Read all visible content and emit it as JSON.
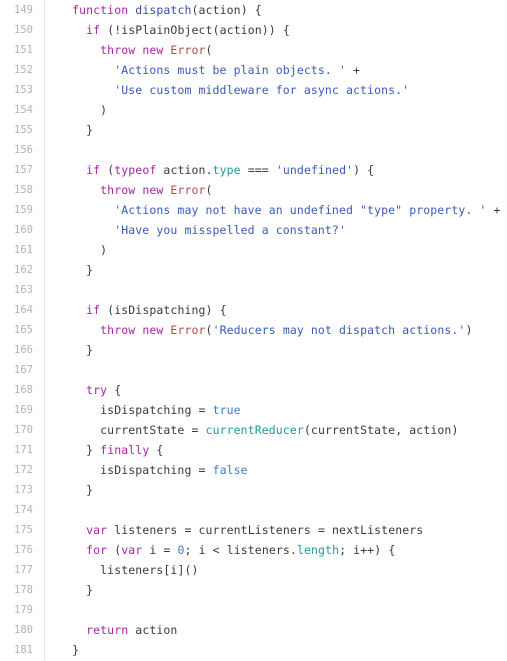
{
  "viewer": {
    "name": "code-viewer",
    "language": "javascript",
    "background_color": "#ffffff",
    "gutter_divider_color": "#e6e6ea",
    "line_number_color": "#b2b3bb",
    "default_text_color": "#383a42",
    "first_line_number": 149,
    "last_line_number": 181,
    "total_lines": 33
  },
  "theme_colors": {
    "keyword": "#a626a4",
    "string": "#3b5bb5",
    "number": "#3b7cc4",
    "boolean": "#3b7cc4",
    "property": "#1d9b9b",
    "function_call": "#1d9b9b",
    "class_name": "#b34a4a",
    "function_name": "#3b4b9b",
    "plain": "#383a42"
  },
  "lines": [
    {
      "number": "149",
      "text": "  function dispatch(action) {",
      "tokens": [
        {
          "t": "  ",
          "k": "plain"
        },
        {
          "t": "function",
          "k": "keyword"
        },
        {
          "t": " ",
          "k": "plain"
        },
        {
          "t": "dispatch",
          "k": "fnname"
        },
        {
          "t": "(",
          "k": "punct"
        },
        {
          "t": "action",
          "k": "plain"
        },
        {
          "t": ") {",
          "k": "punct"
        }
      ]
    },
    {
      "number": "150",
      "text": "    if (!isPlainObject(action)) {",
      "tokens": [
        {
          "t": "    ",
          "k": "plain"
        },
        {
          "t": "if",
          "k": "keyword"
        },
        {
          "t": " (!",
          "k": "punct"
        },
        {
          "t": "isPlainObject",
          "k": "plain"
        },
        {
          "t": "(",
          "k": "punct"
        },
        {
          "t": "action",
          "k": "plain"
        },
        {
          "t": ")) {",
          "k": "punct"
        }
      ]
    },
    {
      "number": "151",
      "text": "      throw new Error(",
      "tokens": [
        {
          "t": "      ",
          "k": "plain"
        },
        {
          "t": "throw",
          "k": "keyword"
        },
        {
          "t": " ",
          "k": "plain"
        },
        {
          "t": "new",
          "k": "keyword"
        },
        {
          "t": " ",
          "k": "plain"
        },
        {
          "t": "Error",
          "k": "class"
        },
        {
          "t": "(",
          "k": "punct"
        }
      ]
    },
    {
      "number": "152",
      "text": "        'Actions must be plain objects. ' +",
      "tokens": [
        {
          "t": "        ",
          "k": "plain"
        },
        {
          "t": "'Actions must be plain objects. '",
          "k": "string"
        },
        {
          "t": " ",
          "k": "plain"
        },
        {
          "t": "+",
          "k": "operator"
        }
      ]
    },
    {
      "number": "153",
      "text": "        'Use custom middleware for async actions.'",
      "tokens": [
        {
          "t": "        ",
          "k": "plain"
        },
        {
          "t": "'Use custom middleware for async actions.'",
          "k": "string"
        }
      ]
    },
    {
      "number": "154",
      "text": "      )",
      "tokens": [
        {
          "t": "      ",
          "k": "plain"
        },
        {
          "t": ")",
          "k": "punct"
        }
      ]
    },
    {
      "number": "155",
      "text": "    }",
      "tokens": [
        {
          "t": "    ",
          "k": "plain"
        },
        {
          "t": "}",
          "k": "punct"
        }
      ]
    },
    {
      "number": "156",
      "text": "",
      "tokens": []
    },
    {
      "number": "157",
      "text": "    if (typeof action.type === 'undefined') {",
      "tokens": [
        {
          "t": "    ",
          "k": "plain"
        },
        {
          "t": "if",
          "k": "keyword"
        },
        {
          "t": " (",
          "k": "punct"
        },
        {
          "t": "typeof",
          "k": "keyword"
        },
        {
          "t": " ",
          "k": "plain"
        },
        {
          "t": "action",
          "k": "plain"
        },
        {
          "t": ".",
          "k": "punct"
        },
        {
          "t": "type",
          "k": "property"
        },
        {
          "t": " ",
          "k": "plain"
        },
        {
          "t": "===",
          "k": "operator"
        },
        {
          "t": " ",
          "k": "plain"
        },
        {
          "t": "'undefined'",
          "k": "string"
        },
        {
          "t": ") {",
          "k": "punct"
        }
      ]
    },
    {
      "number": "158",
      "text": "      throw new Error(",
      "tokens": [
        {
          "t": "      ",
          "k": "plain"
        },
        {
          "t": "throw",
          "k": "keyword"
        },
        {
          "t": " ",
          "k": "plain"
        },
        {
          "t": "new",
          "k": "keyword"
        },
        {
          "t": " ",
          "k": "plain"
        },
        {
          "t": "Error",
          "k": "class"
        },
        {
          "t": "(",
          "k": "punct"
        }
      ]
    },
    {
      "number": "159",
      "text": "        'Actions may not have an undefined \"type\" property. ' +",
      "tokens": [
        {
          "t": "        ",
          "k": "plain"
        },
        {
          "t": "'Actions may not have an undefined \"type\" property. '",
          "k": "string"
        },
        {
          "t": " ",
          "k": "plain"
        },
        {
          "t": "+",
          "k": "operator"
        }
      ]
    },
    {
      "number": "160",
      "text": "        'Have you misspelled a constant?'",
      "tokens": [
        {
          "t": "        ",
          "k": "plain"
        },
        {
          "t": "'Have you misspelled a constant?'",
          "k": "string"
        }
      ]
    },
    {
      "number": "161",
      "text": "      )",
      "tokens": [
        {
          "t": "      ",
          "k": "plain"
        },
        {
          "t": ")",
          "k": "punct"
        }
      ]
    },
    {
      "number": "162",
      "text": "    }",
      "tokens": [
        {
          "t": "    ",
          "k": "plain"
        },
        {
          "t": "}",
          "k": "punct"
        }
      ]
    },
    {
      "number": "163",
      "text": "",
      "tokens": []
    },
    {
      "number": "164",
      "text": "    if (isDispatching) {",
      "tokens": [
        {
          "t": "    ",
          "k": "plain"
        },
        {
          "t": "if",
          "k": "keyword"
        },
        {
          "t": " (",
          "k": "punct"
        },
        {
          "t": "isDispatching",
          "k": "plain"
        },
        {
          "t": ") {",
          "k": "punct"
        }
      ]
    },
    {
      "number": "165",
      "text": "      throw new Error('Reducers may not dispatch actions.')",
      "tokens": [
        {
          "t": "      ",
          "k": "plain"
        },
        {
          "t": "throw",
          "k": "keyword"
        },
        {
          "t": " ",
          "k": "plain"
        },
        {
          "t": "new",
          "k": "keyword"
        },
        {
          "t": " ",
          "k": "plain"
        },
        {
          "t": "Error",
          "k": "class"
        },
        {
          "t": "(",
          "k": "punct"
        },
        {
          "t": "'Reducers may not dispatch actions.'",
          "k": "string"
        },
        {
          "t": ")",
          "k": "punct"
        }
      ]
    },
    {
      "number": "166",
      "text": "    }",
      "tokens": [
        {
          "t": "    ",
          "k": "plain"
        },
        {
          "t": "}",
          "k": "punct"
        }
      ]
    },
    {
      "number": "167",
      "text": "",
      "tokens": []
    },
    {
      "number": "168",
      "text": "    try {",
      "tokens": [
        {
          "t": "    ",
          "k": "plain"
        },
        {
          "t": "try",
          "k": "keyword"
        },
        {
          "t": " {",
          "k": "punct"
        }
      ]
    },
    {
      "number": "169",
      "text": "      isDispatching = true",
      "tokens": [
        {
          "t": "      ",
          "k": "plain"
        },
        {
          "t": "isDispatching",
          "k": "plain"
        },
        {
          "t": " ",
          "k": "plain"
        },
        {
          "t": "=",
          "k": "operator"
        },
        {
          "t": " ",
          "k": "plain"
        },
        {
          "t": "true",
          "k": "boolean"
        }
      ]
    },
    {
      "number": "170",
      "text": "      currentState = currentReducer(currentState, action)",
      "tokens": [
        {
          "t": "      ",
          "k": "plain"
        },
        {
          "t": "currentState",
          "k": "plain"
        },
        {
          "t": " ",
          "k": "plain"
        },
        {
          "t": "=",
          "k": "operator"
        },
        {
          "t": " ",
          "k": "plain"
        },
        {
          "t": "currentReducer",
          "k": "function"
        },
        {
          "t": "(",
          "k": "punct"
        },
        {
          "t": "currentState",
          "k": "plain"
        },
        {
          "t": ", ",
          "k": "punct"
        },
        {
          "t": "action",
          "k": "plain"
        },
        {
          "t": ")",
          "k": "punct"
        }
      ]
    },
    {
      "number": "171",
      "text": "    } finally {",
      "tokens": [
        {
          "t": "    ",
          "k": "plain"
        },
        {
          "t": "} ",
          "k": "punct"
        },
        {
          "t": "finally",
          "k": "keyword"
        },
        {
          "t": " {",
          "k": "punct"
        }
      ]
    },
    {
      "number": "172",
      "text": "      isDispatching = false",
      "tokens": [
        {
          "t": "      ",
          "k": "plain"
        },
        {
          "t": "isDispatching",
          "k": "plain"
        },
        {
          "t": " ",
          "k": "plain"
        },
        {
          "t": "=",
          "k": "operator"
        },
        {
          "t": " ",
          "k": "plain"
        },
        {
          "t": "false",
          "k": "boolean"
        }
      ]
    },
    {
      "number": "173",
      "text": "    }",
      "tokens": [
        {
          "t": "    ",
          "k": "plain"
        },
        {
          "t": "}",
          "k": "punct"
        }
      ]
    },
    {
      "number": "174",
      "text": "",
      "tokens": []
    },
    {
      "number": "175",
      "text": "    var listeners = currentListeners = nextListeners",
      "tokens": [
        {
          "t": "    ",
          "k": "plain"
        },
        {
          "t": "var",
          "k": "keyword"
        },
        {
          "t": " ",
          "k": "plain"
        },
        {
          "t": "listeners",
          "k": "plain"
        },
        {
          "t": " ",
          "k": "plain"
        },
        {
          "t": "=",
          "k": "operator"
        },
        {
          "t": " ",
          "k": "plain"
        },
        {
          "t": "currentListeners",
          "k": "plain"
        },
        {
          "t": " ",
          "k": "plain"
        },
        {
          "t": "=",
          "k": "operator"
        },
        {
          "t": " ",
          "k": "plain"
        },
        {
          "t": "nextListeners",
          "k": "plain"
        }
      ]
    },
    {
      "number": "176",
      "text": "    for (var i = 0; i < listeners.length; i++) {",
      "tokens": [
        {
          "t": "    ",
          "k": "plain"
        },
        {
          "t": "for",
          "k": "keyword"
        },
        {
          "t": " (",
          "k": "punct"
        },
        {
          "t": "var",
          "k": "keyword"
        },
        {
          "t": " ",
          "k": "plain"
        },
        {
          "t": "i",
          "k": "plain"
        },
        {
          "t": " ",
          "k": "plain"
        },
        {
          "t": "=",
          "k": "operator"
        },
        {
          "t": " ",
          "k": "plain"
        },
        {
          "t": "0",
          "k": "number"
        },
        {
          "t": "; ",
          "k": "punct"
        },
        {
          "t": "i",
          "k": "plain"
        },
        {
          "t": " ",
          "k": "plain"
        },
        {
          "t": "<",
          "k": "operator"
        },
        {
          "t": " ",
          "k": "plain"
        },
        {
          "t": "listeners",
          "k": "plain"
        },
        {
          "t": ".",
          "k": "punct"
        },
        {
          "t": "length",
          "k": "property"
        },
        {
          "t": "; ",
          "k": "punct"
        },
        {
          "t": "i",
          "k": "plain"
        },
        {
          "t": "++",
          "k": "operator"
        },
        {
          "t": ") {",
          "k": "punct"
        }
      ]
    },
    {
      "number": "177",
      "text": "      listeners[i]()",
      "tokens": [
        {
          "t": "      ",
          "k": "plain"
        },
        {
          "t": "listeners",
          "k": "plain"
        },
        {
          "t": "[",
          "k": "punct"
        },
        {
          "t": "i",
          "k": "plain"
        },
        {
          "t": "]()",
          "k": "punct"
        }
      ]
    },
    {
      "number": "178",
      "text": "    }",
      "tokens": [
        {
          "t": "    ",
          "k": "plain"
        },
        {
          "t": "}",
          "k": "punct"
        }
      ]
    },
    {
      "number": "179",
      "text": "",
      "tokens": []
    },
    {
      "number": "180",
      "text": "    return action",
      "tokens": [
        {
          "t": "    ",
          "k": "plain"
        },
        {
          "t": "return",
          "k": "keyword"
        },
        {
          "t": " ",
          "k": "plain"
        },
        {
          "t": "action",
          "k": "plain"
        }
      ]
    },
    {
      "number": "181",
      "text": "  }",
      "tokens": [
        {
          "t": "  ",
          "k": "plain"
        },
        {
          "t": "}",
          "k": "punct"
        }
      ]
    }
  ]
}
